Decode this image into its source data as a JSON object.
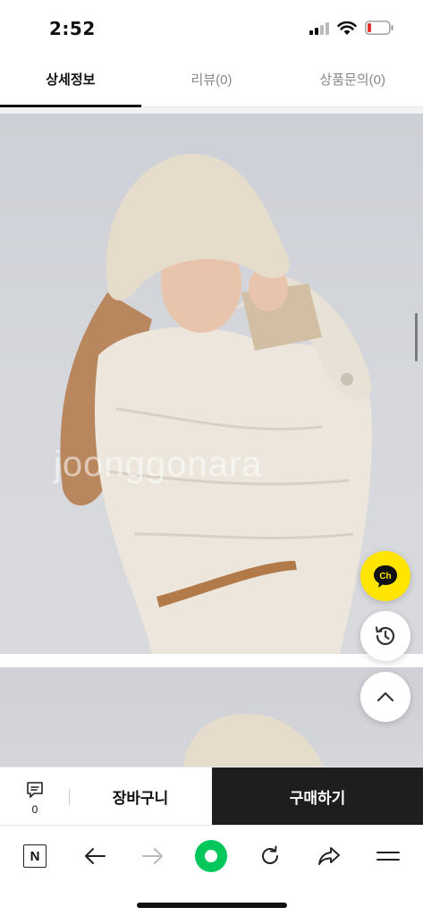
{
  "status_bar": {
    "time": "2:52"
  },
  "tabs": [
    {
      "label": "상세정보",
      "active": true
    },
    {
      "label": "리뷰(0)",
      "active": false
    },
    {
      "label": "상품문의(0)",
      "active": false
    }
  ],
  "product_images": {
    "watermark": "joonggonara"
  },
  "floating": {
    "chat_label": "Ch"
  },
  "purchase_bar": {
    "review_count": "0",
    "cart_label": "장바구니",
    "buy_label": "구매하기"
  },
  "browser_toolbar": {
    "naver_label": "N"
  },
  "colors": {
    "chat_yellow": "#ffe500",
    "buy_dark": "#1e1e1e",
    "naver_green": "#03c75a"
  },
  "icons": [
    "signal-icon",
    "wifi-icon",
    "battery-icon",
    "chat-icon",
    "history-icon",
    "chevron-up-icon",
    "comment-icon",
    "back-arrow-icon",
    "forward-arrow-icon",
    "refresh-icon",
    "share-icon",
    "menu-icon"
  ]
}
